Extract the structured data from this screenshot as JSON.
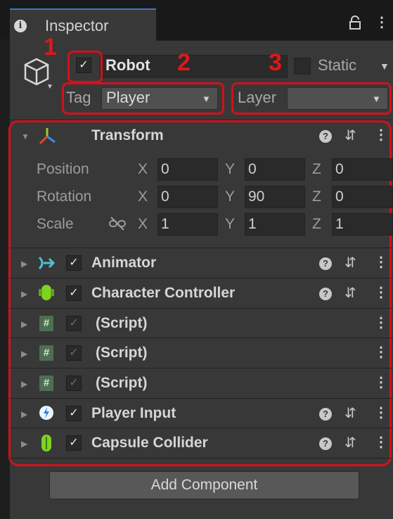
{
  "tab": {
    "title": "Inspector"
  },
  "header": {
    "object_name": "Robot",
    "active": true,
    "static_label": "Static",
    "tag_label": "Tag",
    "tag_value": "Player",
    "layer_label": "Layer",
    "layer_value": ""
  },
  "annotations": [
    "1",
    "2",
    "3"
  ],
  "colors": {
    "annotation_red": "#d4101c",
    "tab_accent": "#3a79bb"
  },
  "transform": {
    "title": "Transform",
    "rows": [
      {
        "label": "Position",
        "x": "0",
        "y": "0",
        "z": "0"
      },
      {
        "label": "Rotation",
        "x": "0",
        "y": "90",
        "z": "0"
      },
      {
        "label": "Scale",
        "x": "1",
        "y": "1",
        "z": "1"
      }
    ],
    "axis": {
      "x": "X",
      "y": "Y",
      "z": "Z"
    }
  },
  "components": [
    {
      "title": "Animator",
      "icon": "animator-icon",
      "enabled": true,
      "help": true
    },
    {
      "title": "Character Controller",
      "icon": "character-controller-icon",
      "enabled": true,
      "help": true
    },
    {
      "title": "(Script)",
      "icon": "script-icon",
      "enabled": true,
      "help": false
    },
    {
      "title": "(Script)",
      "icon": "script-icon",
      "enabled": true,
      "help": false
    },
    {
      "title": "(Script)",
      "icon": "script-icon",
      "enabled": true,
      "help": false
    },
    {
      "title": "Player Input",
      "icon": "player-input-icon",
      "enabled": true,
      "help": true
    },
    {
      "title": "Capsule Collider",
      "icon": "capsule-collider-icon",
      "enabled": true,
      "help": true
    }
  ],
  "add_component_label": "Add Component"
}
